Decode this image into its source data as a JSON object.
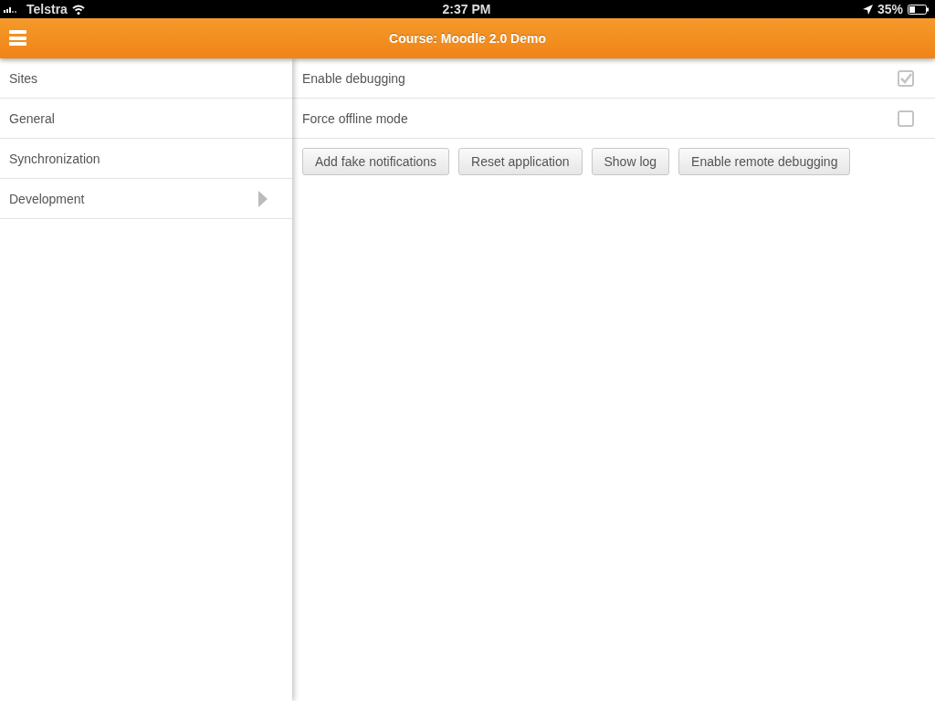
{
  "status_bar": {
    "carrier": "Telstra",
    "time": "2:37 PM",
    "battery": "35%"
  },
  "header": {
    "title": "Course: Moodle 2.0 Demo"
  },
  "sidebar": {
    "items": [
      {
        "label": "Sites",
        "selected": false
      },
      {
        "label": "General",
        "selected": false
      },
      {
        "label": "Synchronization",
        "selected": false
      },
      {
        "label": "Development",
        "selected": true
      }
    ]
  },
  "settings": [
    {
      "label": "Enable debugging",
      "checked": true
    },
    {
      "label": "Force offline mode",
      "checked": false
    }
  ],
  "buttons": [
    "Add fake notifications",
    "Reset application",
    "Show log",
    "Enable remote debugging"
  ]
}
